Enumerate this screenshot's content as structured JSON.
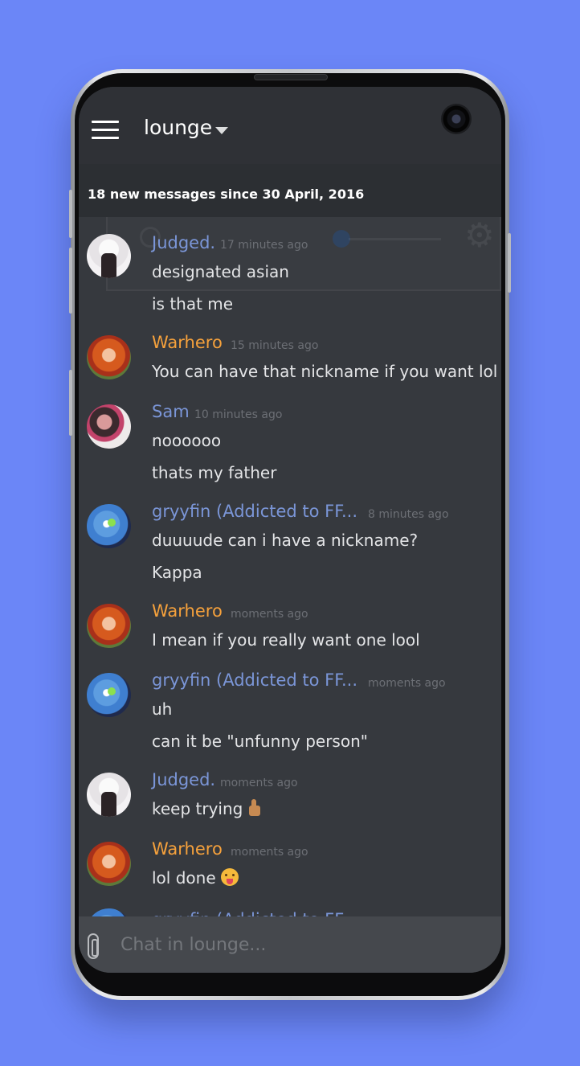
{
  "header": {
    "channel": "lounge"
  },
  "banner": {
    "text": "18 new messages since 30 April, 2016"
  },
  "messages": [
    {
      "user": "Judged.",
      "time": "17 minutes ago",
      "lines": [
        "designated asian",
        "is that me"
      ]
    },
    {
      "user": "Warhero",
      "time": "15 minutes ago",
      "lines": [
        "You can have that nickname if you want lol"
      ]
    },
    {
      "user": "Sam",
      "time": "10 minutes ago",
      "lines": [
        "noooooo",
        "thats my father"
      ]
    },
    {
      "user": "gryyfin (Addicted to FF...",
      "time": "8 minutes ago",
      "lines": [
        "duuuude can i have a nickname?",
        "Kappa"
      ]
    },
    {
      "user": "Warhero",
      "time": "moments ago",
      "lines": [
        "I mean if you really want one lool"
      ]
    },
    {
      "user": "gryyfin (Addicted to FF...",
      "time": "moments ago",
      "lines": [
        "uh",
        "can it be \"unfunny person\""
      ]
    },
    {
      "user": "Judged.",
      "time": "moments ago",
      "lines": [
        "keep trying"
      ],
      "emoji": "thumbs-up"
    },
    {
      "user": "Warhero",
      "time": "moments ago",
      "lines": [
        "lol done"
      ],
      "emoji": "face-with-tongue"
    }
  ],
  "composer": {
    "placeholder": "Chat in lounge..."
  },
  "colors": {
    "background": "#6b86f7",
    "chat_bg": "#36393e",
    "username_blue": "#7b96d8",
    "username_orange": "#f5a13c"
  }
}
